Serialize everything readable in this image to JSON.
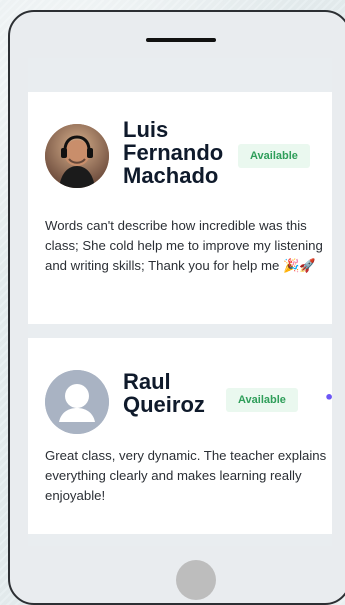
{
  "reviews": [
    {
      "name": "Luis Fernando Machado",
      "status": "Available",
      "text": "Words can't describe how incredible was this class; She cold help me to improve my listening and writing skills; Thank you for help me 🎉🚀"
    },
    {
      "name": "Raul Queiroz",
      "status": "Available",
      "text": "Great class, very dynamic. The teacher explains everything clearly and makes learning really enjoyable!"
    }
  ],
  "icons": {
    "more": "•••",
    "avatar_photo": "user-photo-icon",
    "avatar_placeholder": "user-placeholder-icon"
  },
  "colors": {
    "badge_bg": "#eaf8ef",
    "badge_text": "#2f9e5a",
    "more_icon": "#6c56f5"
  }
}
